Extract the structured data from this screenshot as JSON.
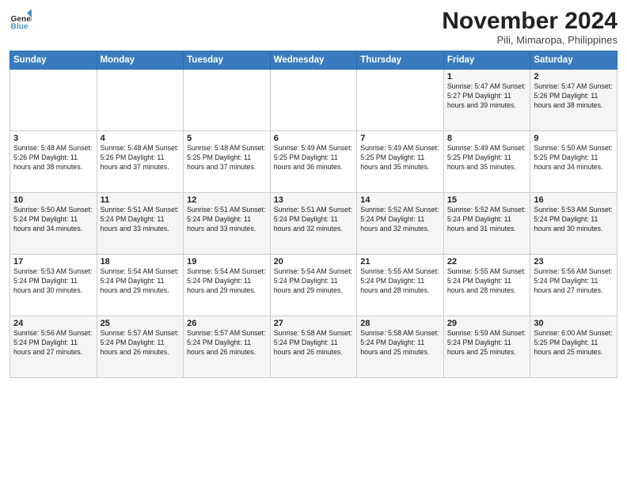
{
  "header": {
    "logo_general": "General",
    "logo_blue": "Blue",
    "month_title": "November 2024",
    "location": "Pili, Mimaropa, Philippines"
  },
  "weekdays": [
    "Sunday",
    "Monday",
    "Tuesday",
    "Wednesday",
    "Thursday",
    "Friday",
    "Saturday"
  ],
  "weeks": [
    [
      {
        "day": "",
        "info": ""
      },
      {
        "day": "",
        "info": ""
      },
      {
        "day": "",
        "info": ""
      },
      {
        "day": "",
        "info": ""
      },
      {
        "day": "",
        "info": ""
      },
      {
        "day": "1",
        "info": "Sunrise: 5:47 AM\nSunset: 5:27 PM\nDaylight: 11 hours\nand 39 minutes."
      },
      {
        "day": "2",
        "info": "Sunrise: 5:47 AM\nSunset: 5:26 PM\nDaylight: 11 hours\nand 38 minutes."
      }
    ],
    [
      {
        "day": "3",
        "info": "Sunrise: 5:48 AM\nSunset: 5:26 PM\nDaylight: 11 hours\nand 38 minutes."
      },
      {
        "day": "4",
        "info": "Sunrise: 5:48 AM\nSunset: 5:26 PM\nDaylight: 11 hours\nand 37 minutes."
      },
      {
        "day": "5",
        "info": "Sunrise: 5:48 AM\nSunset: 5:25 PM\nDaylight: 11 hours\nand 37 minutes."
      },
      {
        "day": "6",
        "info": "Sunrise: 5:49 AM\nSunset: 5:25 PM\nDaylight: 11 hours\nand 36 minutes."
      },
      {
        "day": "7",
        "info": "Sunrise: 5:49 AM\nSunset: 5:25 PM\nDaylight: 11 hours\nand 35 minutes."
      },
      {
        "day": "8",
        "info": "Sunrise: 5:49 AM\nSunset: 5:25 PM\nDaylight: 11 hours\nand 35 minutes."
      },
      {
        "day": "9",
        "info": "Sunrise: 5:50 AM\nSunset: 5:25 PM\nDaylight: 11 hours\nand 34 minutes."
      }
    ],
    [
      {
        "day": "10",
        "info": "Sunrise: 5:50 AM\nSunset: 5:24 PM\nDaylight: 11 hours\nand 34 minutes."
      },
      {
        "day": "11",
        "info": "Sunrise: 5:51 AM\nSunset: 5:24 PM\nDaylight: 11 hours\nand 33 minutes."
      },
      {
        "day": "12",
        "info": "Sunrise: 5:51 AM\nSunset: 5:24 PM\nDaylight: 11 hours\nand 33 minutes."
      },
      {
        "day": "13",
        "info": "Sunrise: 5:51 AM\nSunset: 5:24 PM\nDaylight: 11 hours\nand 32 minutes."
      },
      {
        "day": "14",
        "info": "Sunrise: 5:52 AM\nSunset: 5:24 PM\nDaylight: 11 hours\nand 32 minutes."
      },
      {
        "day": "15",
        "info": "Sunrise: 5:52 AM\nSunset: 5:24 PM\nDaylight: 11 hours\nand 31 minutes."
      },
      {
        "day": "16",
        "info": "Sunrise: 5:53 AM\nSunset: 5:24 PM\nDaylight: 11 hours\nand 30 minutes."
      }
    ],
    [
      {
        "day": "17",
        "info": "Sunrise: 5:53 AM\nSunset: 5:24 PM\nDaylight: 11 hours\nand 30 minutes."
      },
      {
        "day": "18",
        "info": "Sunrise: 5:54 AM\nSunset: 5:24 PM\nDaylight: 11 hours\nand 29 minutes."
      },
      {
        "day": "19",
        "info": "Sunrise: 5:54 AM\nSunset: 5:24 PM\nDaylight: 11 hours\nand 29 minutes."
      },
      {
        "day": "20",
        "info": "Sunrise: 5:54 AM\nSunset: 5:24 PM\nDaylight: 11 hours\nand 29 minutes."
      },
      {
        "day": "21",
        "info": "Sunrise: 5:55 AM\nSunset: 5:24 PM\nDaylight: 11 hours\nand 28 minutes."
      },
      {
        "day": "22",
        "info": "Sunrise: 5:55 AM\nSunset: 5:24 PM\nDaylight: 11 hours\nand 28 minutes."
      },
      {
        "day": "23",
        "info": "Sunrise: 5:56 AM\nSunset: 5:24 PM\nDaylight: 11 hours\nand 27 minutes."
      }
    ],
    [
      {
        "day": "24",
        "info": "Sunrise: 5:56 AM\nSunset: 5:24 PM\nDaylight: 11 hours\nand 27 minutes."
      },
      {
        "day": "25",
        "info": "Sunrise: 5:57 AM\nSunset: 5:24 PM\nDaylight: 11 hours\nand 26 minutes."
      },
      {
        "day": "26",
        "info": "Sunrise: 5:57 AM\nSunset: 5:24 PM\nDaylight: 11 hours\nand 26 minutes."
      },
      {
        "day": "27",
        "info": "Sunrise: 5:58 AM\nSunset: 5:24 PM\nDaylight: 11 hours\nand 26 minutes."
      },
      {
        "day": "28",
        "info": "Sunrise: 5:58 AM\nSunset: 5:24 PM\nDaylight: 11 hours\nand 25 minutes."
      },
      {
        "day": "29",
        "info": "Sunrise: 5:59 AM\nSunset: 5:24 PM\nDaylight: 11 hours\nand 25 minutes."
      },
      {
        "day": "30",
        "info": "Sunrise: 6:00 AM\nSunset: 5:25 PM\nDaylight: 11 hours\nand 25 minutes."
      }
    ]
  ]
}
